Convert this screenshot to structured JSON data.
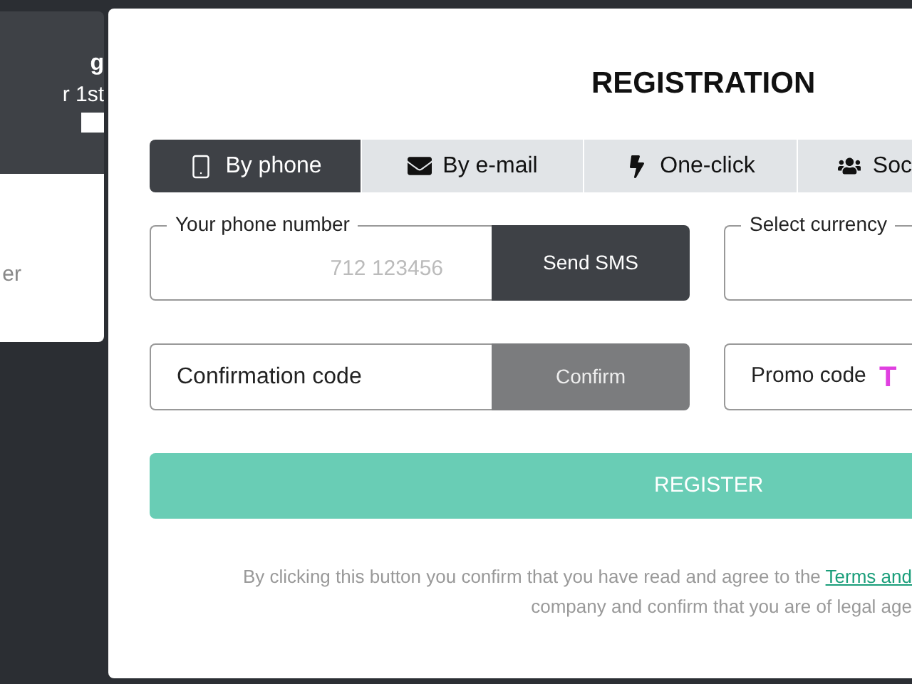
{
  "side_card": {
    "title": "g",
    "subtitle": "r 1st",
    "body": "er"
  },
  "dialog": {
    "title": "REGISTRATION",
    "tabs": [
      {
        "label": "By phone",
        "kind": "phone",
        "selected": true
      },
      {
        "label": "By e-mail",
        "kind": "email",
        "selected": false
      },
      {
        "label": "One-click",
        "kind": "oneclick",
        "selected": false
      },
      {
        "label": "Soc",
        "kind": "social",
        "selected": false
      }
    ],
    "phone_field": {
      "label": "Your phone number",
      "placeholder": "712 123456",
      "button": "Send SMS"
    },
    "currency_field": {
      "label": "Select currency"
    },
    "code_field": {
      "placeholder": "Confirmation code",
      "button": "Confirm"
    },
    "promo_field": {
      "placeholder": "Promo code",
      "badge": "T"
    },
    "register_button": "REGISTER",
    "terms": {
      "line_1": "By clicking this button you confirm that you have read and agree to the",
      "link": "Terms and",
      "line_2": "company and confirm that you are of legal age"
    }
  }
}
